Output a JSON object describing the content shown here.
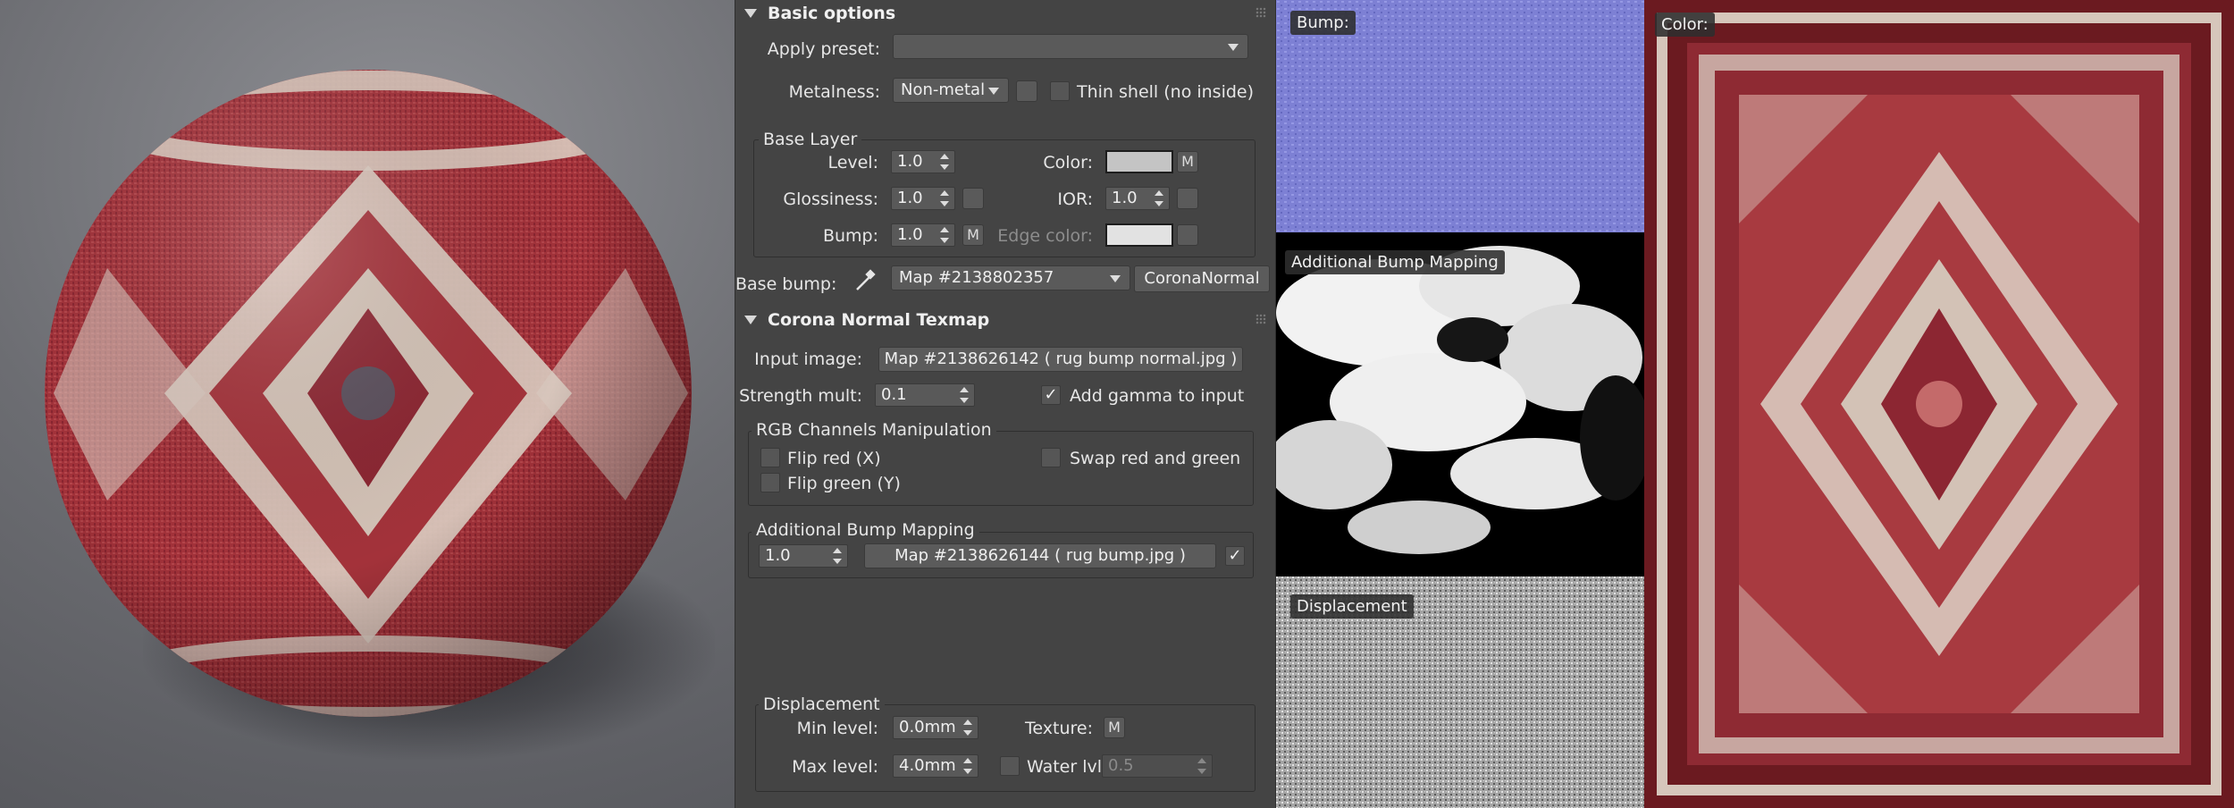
{
  "colors": {
    "panel_bg": "#444444",
    "rug_red": "#a3323a",
    "rug_cream": "#d9cabf",
    "bump_blue": "#7d80d4"
  },
  "basic_options": {
    "title": "Basic options",
    "apply_preset_label": "Apply preset:",
    "apply_preset_value": "",
    "metalness_label": "Metalness:",
    "metalness_value": "Non-metal",
    "thin_shell_label": "Thin shell (no inside)",
    "thin_shell_checked": false
  },
  "base_layer": {
    "title": "Base Layer",
    "level_label": "Level:",
    "level_value": "1.0",
    "color_label": "Color:",
    "color_map_button": "M",
    "color_swatch": "#c4c4c4",
    "glossiness_label": "Glossiness:",
    "glossiness_value": "1.0",
    "ior_label": "IOR:",
    "ior_value": "1.0",
    "bump_label": "Bump:",
    "bump_value": "1.0",
    "bump_map_button": "M",
    "edge_color_label": "Edge color:",
    "edge_color_swatch": "#e2e2e2"
  },
  "base_bump": {
    "label": "Base bump:",
    "map_value": "Map #2138802357",
    "type_button": "CoronaNormal",
    "picker_icon": "eyedropper-icon"
  },
  "normal_texmap": {
    "title": "Corona Normal Texmap",
    "input_image_label": "Input image:",
    "input_image_value": "Map #2138626142 ( rug bump normal.jpg )",
    "strength_label": "Strength mult:",
    "strength_value": "0.1",
    "add_gamma_label": "Add gamma to input",
    "add_gamma_checked": true,
    "rgb_group_title": "RGB Channels Manipulation",
    "flip_red_label": "Flip red (X)",
    "flip_green_label": "Flip green (Y)",
    "swap_label": "Swap red and green",
    "additional_group_title": "Additional Bump Mapping",
    "additional_amount": "1.0",
    "additional_map": "Map #2138626144 ( rug bump.jpg )",
    "additional_checked": true
  },
  "displacement": {
    "title": "Displacement",
    "min_label": "Min level:",
    "min_value": "0.0mm",
    "texture_label": "Texture:",
    "texture_button": "M",
    "max_label": "Max level:",
    "max_value": "4.0mm",
    "water_label": "Water lvl.",
    "water_value": "0.5"
  },
  "tiles": {
    "bump_label": "Bump:",
    "additional_label": "Additional Bump Mapping",
    "displacement_label": "Displacement",
    "color_label": "Color:"
  }
}
